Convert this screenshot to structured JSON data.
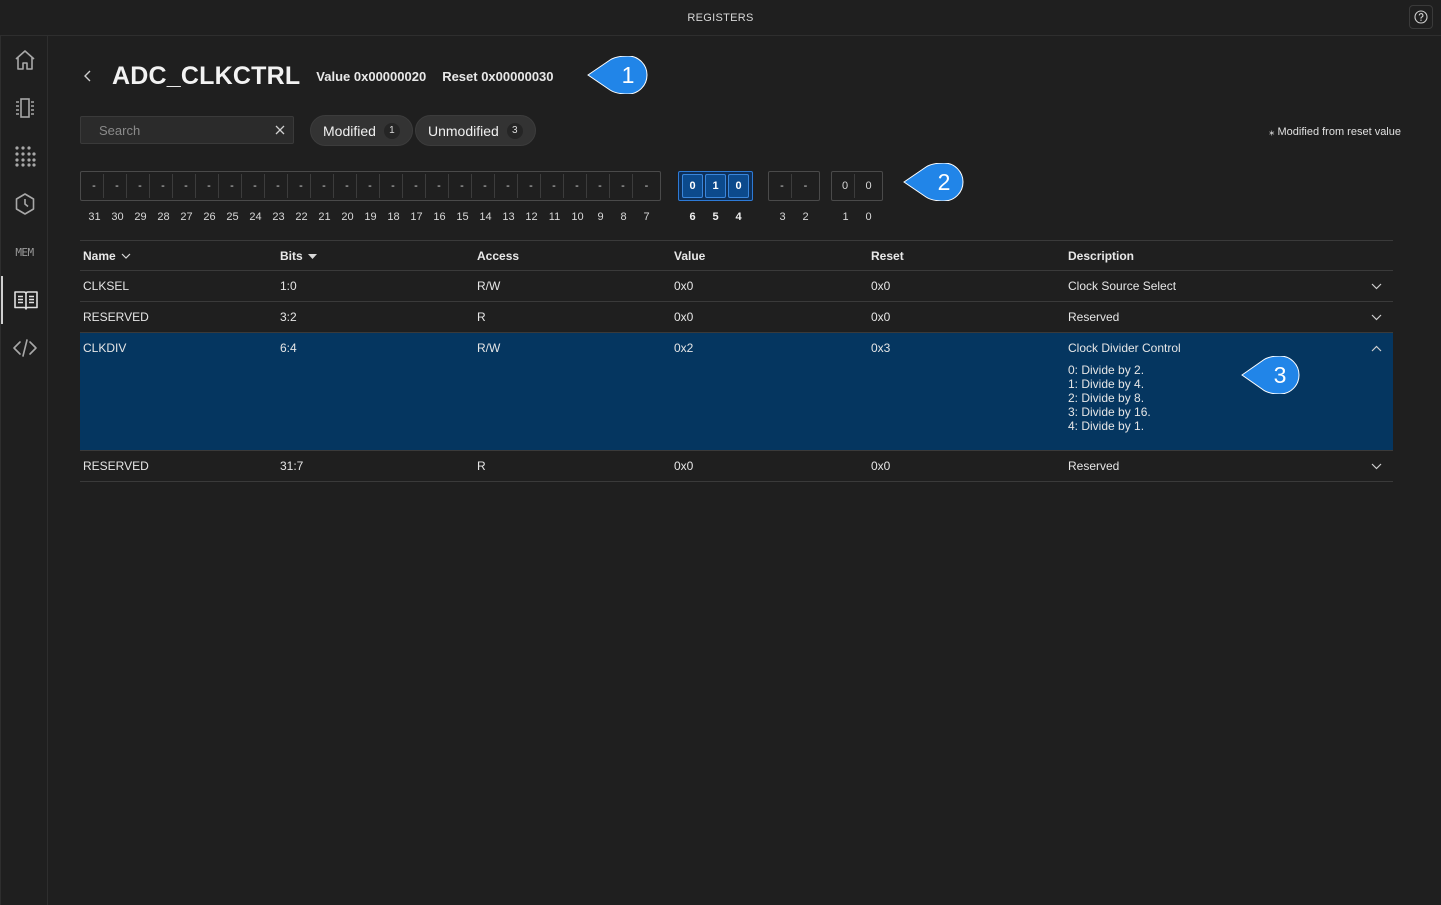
{
  "window": {
    "title": "REGISTERS"
  },
  "sidebar": {
    "items": [
      {
        "name": "home-icon"
      },
      {
        "name": "peripherals-icon"
      },
      {
        "name": "pins-icon"
      },
      {
        "name": "clock-icon"
      },
      {
        "name": "memory-label",
        "label": "MEM"
      },
      {
        "name": "register-book-icon"
      },
      {
        "name": "code-icon"
      }
    ]
  },
  "header": {
    "register_name": "ADC_CLKCTRL",
    "value_text": "Value 0x00000020",
    "reset_text": "Reset 0x00000030"
  },
  "search": {
    "placeholder": "Search",
    "value": ""
  },
  "filters": {
    "modified": {
      "label": "Modified",
      "count": "1"
    },
    "unmodified": {
      "label": "Unmodified",
      "count": "3"
    }
  },
  "legend_note": "⁎  Modified from reset value",
  "bit_groups": {
    "g_31_7": [
      "-",
      "-",
      "-",
      "-",
      "-",
      "-",
      "-",
      "-",
      "-",
      "-",
      "-",
      "-",
      "-",
      "-",
      "-",
      "-",
      "-",
      "-",
      "-",
      "-",
      "-",
      "-",
      "-",
      "-",
      "-"
    ],
    "g_6_4": [
      "0",
      "1",
      "0"
    ],
    "g_3_2": [
      "-",
      "-"
    ],
    "g_1_0": [
      "0",
      "0"
    ]
  },
  "bit_indices": {
    "g_31_7": [
      "31",
      "30",
      "29",
      "28",
      "27",
      "26",
      "25",
      "24",
      "23",
      "22",
      "21",
      "20",
      "19",
      "18",
      "17",
      "16",
      "15",
      "14",
      "13",
      "12",
      "11",
      "10",
      "9",
      "8",
      "7"
    ],
    "g_6_4": [
      "6",
      "5",
      "4"
    ],
    "g_3_2": [
      "3",
      "2"
    ],
    "g_1_0": [
      "1",
      "0"
    ]
  },
  "table": {
    "headers": {
      "name": "Name",
      "bits": "Bits",
      "access": "Access",
      "value": "Value",
      "reset": "Reset",
      "description": "Description"
    },
    "rows": [
      {
        "name": "CLKSEL",
        "bits": "1:0",
        "access": "R/W",
        "value": "0x0",
        "reset": "0x0",
        "description": "Clock Source Select",
        "expanded": false
      },
      {
        "name": "RESERVED",
        "bits": "3:2",
        "access": "R",
        "value": "0x0",
        "reset": "0x0",
        "description": "Reserved",
        "expanded": false
      },
      {
        "name": "CLKDIV",
        "bits": "6:4",
        "access": "R/W",
        "value": "0x2",
        "reset": "0x3",
        "description": "Clock Divider Control",
        "expanded": true,
        "enums": [
          "0: Divide by 2.",
          "1: Divide by 4.",
          "2: Divide by 8.",
          "3: Divide by 16.",
          "4: Divide by 1."
        ]
      },
      {
        "name": "RESERVED",
        "bits": "31:7",
        "access": "R",
        "value": "0x0",
        "reset": "0x0",
        "description": "Reserved",
        "expanded": false
      }
    ]
  },
  "callouts": [
    "1",
    "2",
    "3"
  ],
  "colors": {
    "accent": "#2d7ad6",
    "selected_row": "#053660",
    "callout": "#2185e8",
    "background": "#1f1f1f"
  }
}
